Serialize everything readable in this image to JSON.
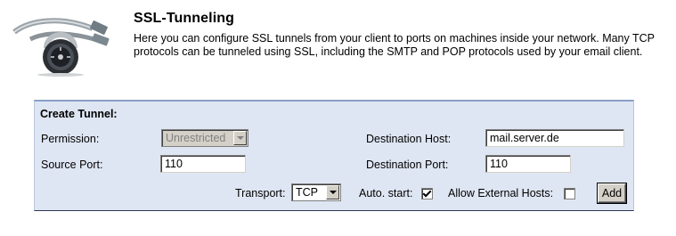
{
  "header": {
    "title": "SSL-Tunneling",
    "description": "Here you can configure SSL tunnels from your client to ports on machines inside your network. Many TCP protocols can be tunneled using SSL, including the SMTP and POP protocols used by your email client."
  },
  "form": {
    "section_title": "Create Tunnel:",
    "permission_label": "Permission:",
    "permission_value": "Unrestricted",
    "source_port_label": "Source Port:",
    "source_port_value": "110",
    "destination_host_label": "Destination Host:",
    "destination_host_value": "mail.server.de",
    "destination_port_label": "Destination Port:",
    "destination_port_value": "110",
    "transport_label": "Transport:",
    "transport_value": "TCP",
    "auto_start_label": "Auto. start:",
    "auto_start_checked": true,
    "allow_external_label": "Allow External Hosts:",
    "allow_external_checked": false,
    "add_label": "Add"
  },
  "colors": {
    "panel_bg": "#dfe6f3",
    "panel_border": "#8aa0c6"
  },
  "icons": {
    "logo": "padlock-cable-icon"
  }
}
